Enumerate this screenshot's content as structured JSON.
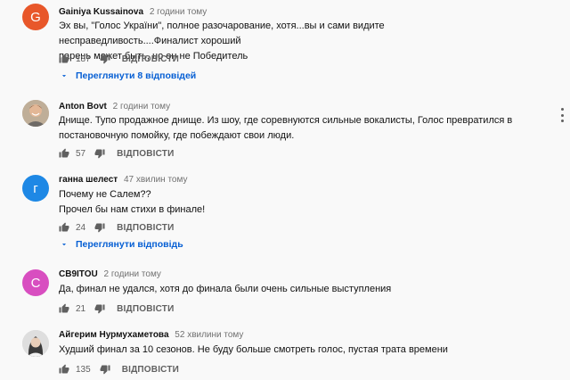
{
  "comments": [
    {
      "author": "Gainiya Kussainova",
      "time": "2 години тому",
      "avatar_letter": "G",
      "avatar_color": "#e8572a",
      "lines": [
        "Эх вы, \"Голос України\", полное разочарование, хотя...вы и сами видите несправедливость....Финалист хороший",
        "парень может быть, но он не Победитель"
      ],
      "likes": "187",
      "reply_label": "ВІДПОВІСТИ",
      "replies_label": "Переглянути 8 відповідей"
    },
    {
      "author": "Anton Bovt",
      "time": "2 години тому",
      "avatar_letter": "",
      "avatar_color": "#c9b9a5",
      "lines": [
        "Днище. Тупо продажное днище. Из шоу, где соревнуются сильные вокалисты, Голос превратился в",
        "постановочную помойку, где побеждают свои люди."
      ],
      "likes": "57",
      "reply_label": "ВІДПОВІСТИ"
    },
    {
      "author": "ганна шелест",
      "time": "47 хвилин тому",
      "avatar_letter": "г",
      "avatar_color": "#1e88e5",
      "lines": [
        "Почему не Салем??",
        "Прочел бы нам стихи в финале!"
      ],
      "likes": "24",
      "reply_label": "ВІДПОВІСТИ",
      "replies_label": "Переглянути відповідь"
    },
    {
      "author": "CB9ITOU",
      "time": "2 години тому",
      "avatar_letter": "C",
      "avatar_color": "#d84ec0",
      "lines": [
        "Да, финал не удался, хотя до финала были очень сильные выступления"
      ],
      "likes": "21",
      "reply_label": "ВІДПОВІСТИ"
    },
    {
      "author": "Айгерим Нурмухаметова",
      "time": "52 хвилини тому",
      "avatar_letter": "",
      "avatar_color": "#d9d9d9",
      "lines": [
        "Худший финал за 10 сезонов. Не буду больше смотреть голос, пустая трата времени"
      ],
      "likes": "135",
      "reply_label": "ВІДПОВІСТИ"
    }
  ],
  "colors": {
    "link_blue": "#065fd4",
    "meta_gray": "#707070"
  },
  "icons": {
    "like": "thumb-up-icon",
    "dislike": "thumb-down-icon",
    "expand": "chevron-down-icon",
    "menu": "more-vert-icon"
  }
}
